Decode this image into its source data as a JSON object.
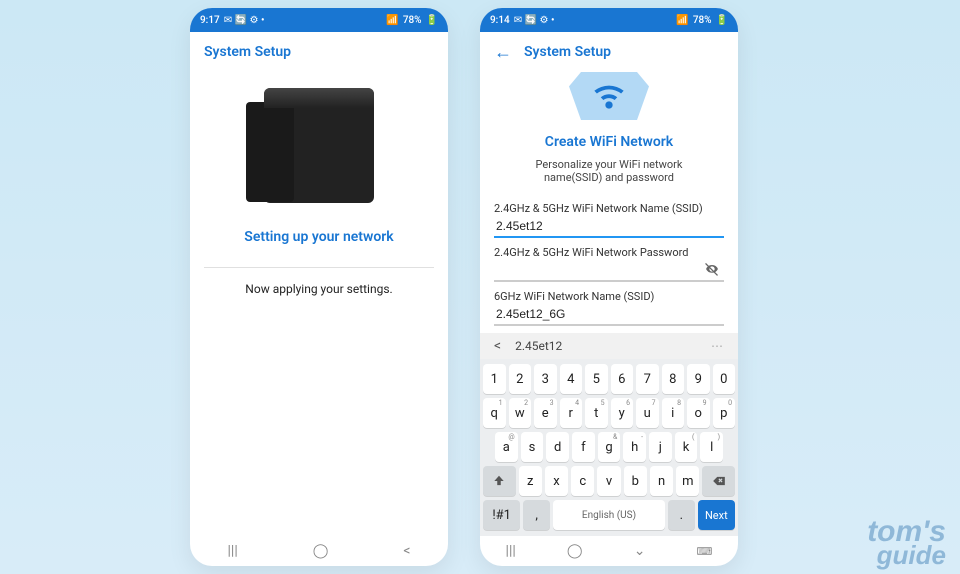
{
  "watermark": {
    "line1": "tom's",
    "line2": "guide"
  },
  "phone1": {
    "status": {
      "time": "9:17",
      "icons_left": "✉ 🔄 ⚙ •",
      "signal": "📶",
      "battery_pct": "78%",
      "battery_icon": "🔋"
    },
    "header": {
      "title": "System Setup"
    },
    "title": "Setting up your network",
    "body": "Now applying your settings."
  },
  "phone2": {
    "status": {
      "time": "9:14",
      "icons_left": "✉ 🔄 ⚙ •",
      "signal": "📶",
      "battery_pct": "78%",
      "battery_icon": "🔋"
    },
    "header": {
      "title": "System Setup"
    },
    "card_title": "Create WiFi Network",
    "card_subtitle": "Personalize your WiFi network name(SSID) and password",
    "field1_label": "2.4GHz & 5GHz WiFi Network Name (SSID)",
    "field1_value": "2.45et12",
    "field2_label": "2.4GHz & 5GHz WiFi Network Password",
    "field2_value": "",
    "field3_label": "6GHz WiFi Network Name (SSID)",
    "field3_value": "2.45et12_6G",
    "suggestion": "2.45et12",
    "keyboard": {
      "row1": [
        "1",
        "2",
        "3",
        "4",
        "5",
        "6",
        "7",
        "8",
        "9",
        "0"
      ],
      "row2": [
        {
          "k": "q",
          "a": "1"
        },
        {
          "k": "w",
          "a": "2"
        },
        {
          "k": "e",
          "a": "3"
        },
        {
          "k": "r",
          "a": "4"
        },
        {
          "k": "t",
          "a": "5"
        },
        {
          "k": "y",
          "a": "6"
        },
        {
          "k": "u",
          "a": "7"
        },
        {
          "k": "i",
          "a": "8"
        },
        {
          "k": "o",
          "a": "9"
        },
        {
          "k": "p",
          "a": "0"
        }
      ],
      "row3": [
        {
          "k": "a",
          "a": "@"
        },
        {
          "k": "s",
          "a": ""
        },
        {
          "k": "d",
          "a": ""
        },
        {
          "k": "f",
          "a": ""
        },
        {
          "k": "g",
          "a": "&"
        },
        {
          "k": "h",
          "a": "-"
        },
        {
          "k": "j",
          "a": ""
        },
        {
          "k": "k",
          "a": "("
        },
        {
          "k": "l",
          "a": ")"
        }
      ],
      "row4": [
        "z",
        "x",
        "c",
        "v",
        "b",
        "n",
        "m"
      ],
      "symbol_key": "!#1",
      "space_label": "English (US)",
      "next_label": "Next",
      "comma": ",",
      "period": "."
    }
  }
}
